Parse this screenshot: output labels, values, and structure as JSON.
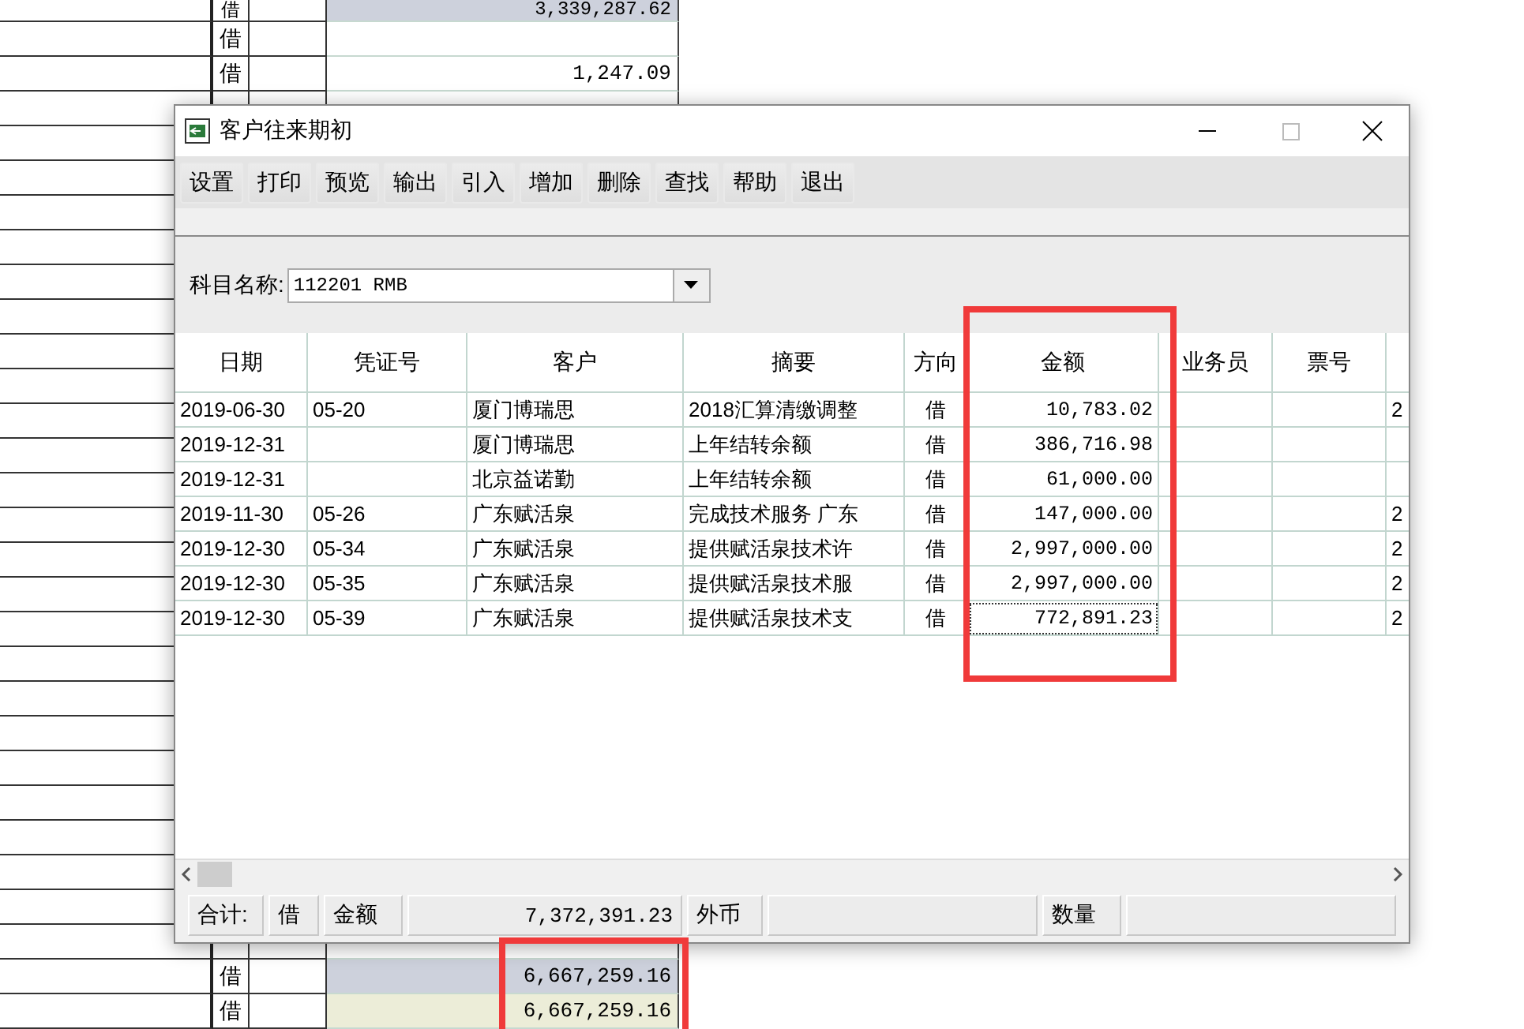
{
  "sheet": {
    "top_rows": [
      {
        "direction": "借",
        "amount": "3,339,287.62",
        "color": "#cdd1dc"
      },
      {
        "direction": "借",
        "color": "#ffffff"
      },
      {
        "direction": "借",
        "amount": "1,247.09",
        "color": "#ffffff"
      }
    ],
    "bottom_rows": [
      {
        "direction": "借",
        "amount": "6,667,259.16",
        "color": "#cdd1dc"
      },
      {
        "direction": "借",
        "amount": "6,667,259.16",
        "color": "#ecedd8"
      }
    ]
  },
  "window": {
    "title": "客户往来期初",
    "toolbar": [
      "设置",
      "打印",
      "预览",
      "输出",
      "引入",
      "增加",
      "删除",
      "查找",
      "帮助",
      "退出"
    ],
    "subject": {
      "label": "科目名称:",
      "value": "112201 RMB"
    },
    "table": {
      "columns": [
        "日期",
        "凭证号",
        "客户",
        "摘要",
        "方向",
        "金额",
        "业务员",
        "票号"
      ],
      "rows": [
        {
          "date": "2019-06-30",
          "voucher": "05-20",
          "customer": "厦门博瑞思",
          "summary": "2018汇算清缴调整",
          "direction": "借",
          "amount": "10,783.02",
          "column_9": "2",
          "focused": false
        },
        {
          "date": "2019-12-31",
          "customer": "厦门博瑞思",
          "summary": "上年结转余额",
          "direction": "借",
          "amount": "386,716.98",
          "focused": false
        },
        {
          "date": "2019-12-31",
          "customer": "北京益诺勤",
          "summary": "上年结转余额",
          "direction": "借",
          "amount": "61,000.00",
          "focused": false
        },
        {
          "date": "2019-11-30",
          "voucher": "05-26",
          "customer": "广东赋活泉",
          "summary": "完成技术服务 广东",
          "direction": "借",
          "amount": "147,000.00",
          "column_9": "2",
          "focused": false
        },
        {
          "date": "2019-12-30",
          "voucher": "05-34",
          "customer": "广东赋活泉",
          "summary": "提供赋活泉技术许",
          "direction": "借",
          "amount": "2,997,000.00",
          "column_9": "2",
          "focused": false
        },
        {
          "date": "2019-12-30",
          "voucher": "05-35",
          "customer": "广东赋活泉",
          "summary": "提供赋活泉技术服",
          "direction": "借",
          "amount": "2,997,000.00",
          "column_9": "2",
          "focused": false
        },
        {
          "date": "2019-12-30",
          "voucher": "05-39",
          "customer": "广东赋活泉",
          "summary": "提供赋活泉技术支",
          "direction": "借",
          "amount": "772,891.23",
          "column_9": "2",
          "focused": true
        }
      ]
    },
    "status_bar": {
      "total_label": "合计:",
      "balance_side": "借",
      "amount_label": "金额",
      "amount": "7,372,391.23",
      "currency_label": "外币",
      "quantity_label": "数量"
    }
  }
}
